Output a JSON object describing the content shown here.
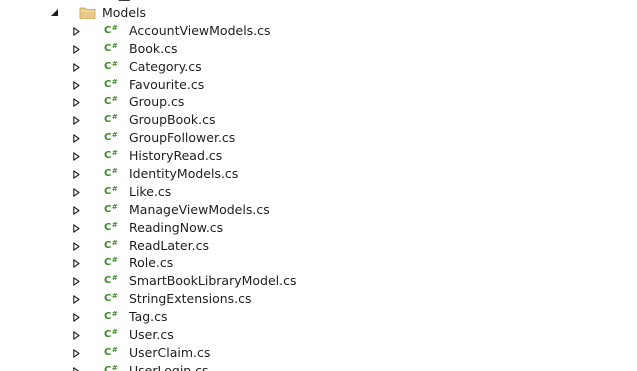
{
  "tree": {
    "cutoff_text": "—",
    "folder": {
      "label": "Models",
      "icon": "folder-icon",
      "expanded": true
    },
    "files": [
      {
        "label": "AccountViewModels.cs"
      },
      {
        "label": "Book.cs"
      },
      {
        "label": "Category.cs"
      },
      {
        "label": "Favourite.cs"
      },
      {
        "label": "Group.cs"
      },
      {
        "label": "GroupBook.cs"
      },
      {
        "label": "GroupFollower.cs"
      },
      {
        "label": "HistoryRead.cs"
      },
      {
        "label": "IdentityModels.cs"
      },
      {
        "label": "Like.cs"
      },
      {
        "label": "ManageViewModels.cs"
      },
      {
        "label": "ReadingNow.cs"
      },
      {
        "label": "ReadLater.cs"
      },
      {
        "label": "Role.cs"
      },
      {
        "label": "SmartBookLibraryModel.cs"
      },
      {
        "label": "StringExtensions.cs"
      },
      {
        "label": "Tag.cs"
      },
      {
        "label": "User.cs"
      },
      {
        "label": "UserClaim.cs"
      },
      {
        "label": "UserLogin.cs"
      }
    ],
    "file_icon_text": "C",
    "file_icon_suffix": "#",
    "colors": {
      "csharp_icon": "#3a8a2a",
      "folder": "#d9b56a",
      "text": "#1e1e1e",
      "expander": "#1e1e1e"
    }
  }
}
